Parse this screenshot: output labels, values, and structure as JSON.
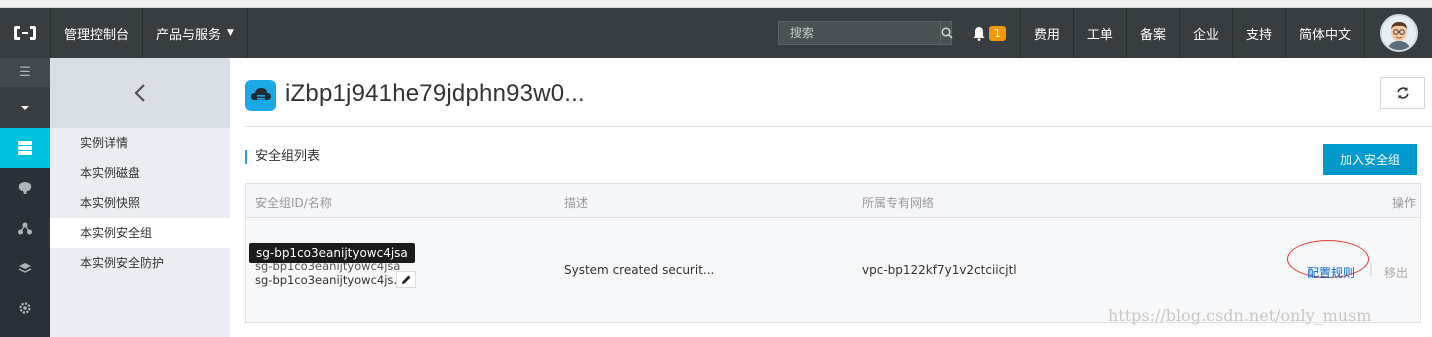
{
  "topbar": {
    "console_label": "管理控制台",
    "products_label": "产品与服务",
    "search_placeholder": "搜索",
    "notification_count": "1",
    "links": [
      "费用",
      "工单",
      "备案",
      "企业",
      "支持",
      "简体中文"
    ]
  },
  "rail": {
    "icons": [
      "menu-icon",
      "chevron-down-icon",
      "server-icon",
      "brain-icon",
      "network-icon",
      "layers-icon",
      "settings-icon"
    ]
  },
  "sidebar": {
    "items": [
      "实例详情",
      "本实例磁盘",
      "本实例快照",
      "本实例安全组",
      "本实例安全防护"
    ],
    "selected_index": 3
  },
  "main": {
    "instance_title": "iZbp1j941he79jdphn93w0...",
    "section_title": "安全组列表",
    "join_button": "加入安全组",
    "table": {
      "headers": [
        "安全组ID/名称",
        "描述",
        "所属专有网络",
        "操作"
      ],
      "rows": [
        {
          "id_tooltip": "sg-bp1co3eanijtyowc4jsa",
          "id_line1": "sg-bp1co3eanijtyowc4jsa",
          "id_line2": "sg-bp1co3eanijtyowc4js...",
          "description": "System created securit...",
          "vpc": "vpc-bp122kf7y1v2ctciicjtl",
          "action_config": "配置规则",
          "action_separator": "|",
          "action_remove": "移出"
        }
      ]
    }
  },
  "watermark": "https://blog.csdn.net/only_musm",
  "colors": {
    "topbar": "#373d41",
    "accent": "#00c1de",
    "primary_button": "#0099cc",
    "link": "#0066cc",
    "badge": "#f39800",
    "highlight_ellipse": "#e0392b"
  }
}
